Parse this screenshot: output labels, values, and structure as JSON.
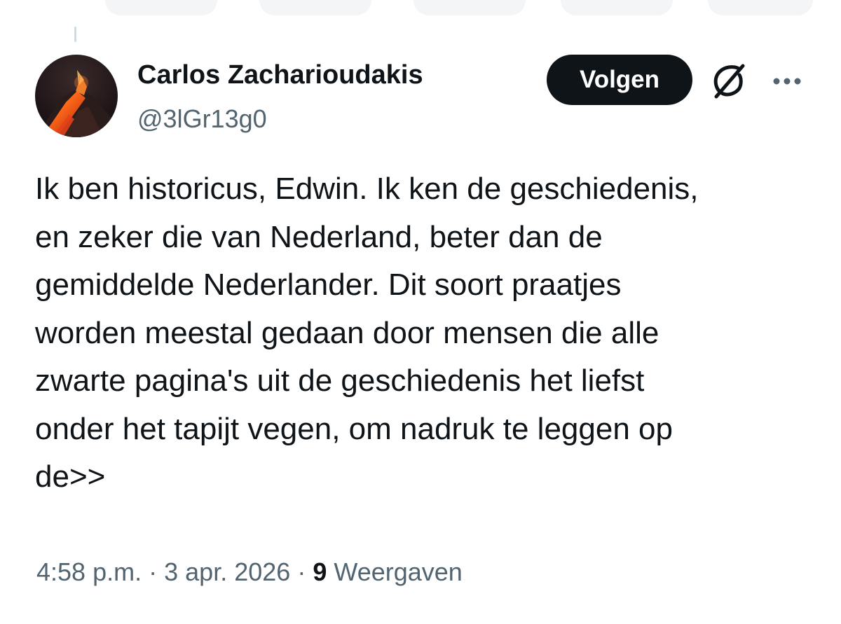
{
  "author": {
    "display_name": "Carlos Zacharioudakis",
    "handle": "@3lGr13g0",
    "avatar_icon": "volcano-avatar"
  },
  "actions": {
    "follow_label": "Volgen",
    "grok_icon": "grok-icon",
    "more_icon": "more-horizontal-icon"
  },
  "tweet": {
    "text": "Ik ben historicus, Edwin. Ik ken de geschiedenis,\nen zeker die van Nederland, beter dan de\ngemiddelde Nederlander. Dit soort praatjes\nworden meestal gedaan door mensen die alle\nzwarte pagina's uit de geschiedenis het liefst\nonder het tapijt vegen, om nadruk te leggen op\nde>>"
  },
  "meta": {
    "time": "4:58 p.m.",
    "separator": "·",
    "date": "3 apr. 2026",
    "views_count": "9",
    "views_label": "Weergaven"
  },
  "colors": {
    "text_primary": "#0f1419",
    "text_secondary": "#536471",
    "button_bg": "#0f1419",
    "button_text": "#ffffff"
  }
}
